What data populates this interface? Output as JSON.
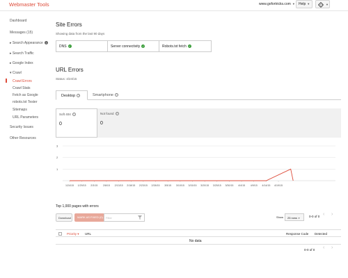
{
  "header": {
    "logo": "Webmaster Tools",
    "site": "www.gofortricks.com",
    "help_label": "Help"
  },
  "sidebar": {
    "items": [
      {
        "label": "Dashboard"
      },
      {
        "label": "Messages (15)"
      },
      {
        "label": "▸ Search Appearance"
      },
      {
        "label": "▸ Search Traffic"
      },
      {
        "label": "▸ Google Index"
      },
      {
        "label": "▾ Crawl"
      },
      {
        "label": "Crawl Errors"
      },
      {
        "label": "Crawl Stats"
      },
      {
        "label": "Fetch as Google"
      },
      {
        "label": "robots.txt Tester"
      },
      {
        "label": "Sitemaps"
      },
      {
        "label": "URL Parameters"
      },
      {
        "label": "Security Issues"
      },
      {
        "label": "Other Resources"
      }
    ],
    "info_icon": "i"
  },
  "site_errors": {
    "title": "Site Errors",
    "subtitle": "Showing data from the last 90 days",
    "cells": [
      "DNS",
      "Server connectivity",
      "Robots.txt fetch"
    ],
    "status_color": "#3a9d3a"
  },
  "url_errors": {
    "title": "URL Errors",
    "status": "Status: 4/24/15",
    "tabs": [
      "Desktop",
      "Smartphone"
    ],
    "metrics": [
      {
        "label": "Soft 404",
        "value": "0"
      },
      {
        "label": "Not found",
        "value": "0"
      }
    ]
  },
  "chart_data": {
    "type": "line",
    "y_ticks": [
      "3",
      "2",
      "1"
    ],
    "x_ticks": [
      "1/24/15",
      "1/29/15",
      "2/3/15",
      "2/8/15",
      "2/13/15",
      "2/18/15",
      "2/23/15",
      "2/28/15",
      "3/5/15",
      "3/10/15",
      "3/15/15",
      "3/20/15",
      "3/25/15",
      "3/30/15",
      "4/4/15",
      "4/9/15",
      "4/14/15",
      "4/19/15"
    ],
    "ylim": [
      0,
      3
    ],
    "grid": true,
    "series": [
      {
        "color": "#dd4b39",
        "points": [
          {
            "x": "1/24/15",
            "y": 0
          },
          {
            "x": "4/14/15",
            "y": 0
          },
          {
            "x": "4/24/15",
            "y": 1
          },
          {
            "x": "4/25/15",
            "y": 0
          }
        ]
      }
    ]
  },
  "table": {
    "title": "Top 1,000 pages with errors",
    "download_label": "Download",
    "mark_fixed_label": "MARK AS FIXED (0)",
    "filter_placeholder": "Filter",
    "show_label": "Show",
    "rows_option": "25 rows",
    "range_top": "0-0 of 0",
    "range_bottom": "0-0 of 0",
    "columns": [
      "Priority ▾",
      "URL",
      "Response Code",
      "Detected"
    ],
    "empty_text": "No data",
    "prev": "‹",
    "next": "›"
  }
}
